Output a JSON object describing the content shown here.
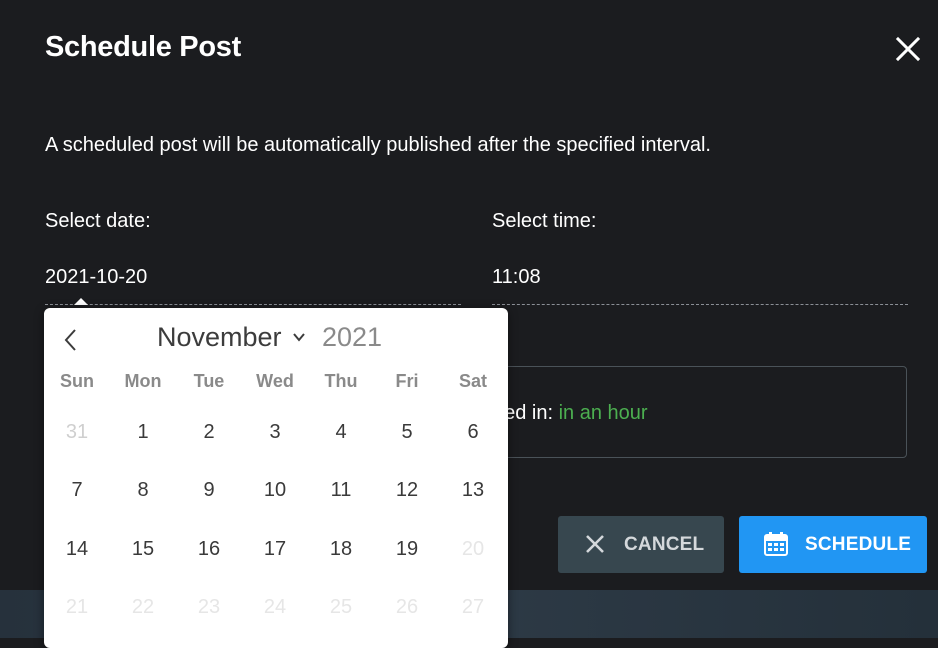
{
  "dialog": {
    "title": "Schedule Post",
    "description": "A scheduled post will be automatically published after the specified interval.",
    "date_label": "Select date:",
    "date_value": "2021-10-20",
    "time_label": "Select time:",
    "time_value": "11:08",
    "publish_info_visible": "hed in: ",
    "publish_info_value": "in an hour",
    "cancel_label": "CANCEL",
    "schedule_label": "SCHEDULE"
  },
  "calendar": {
    "month": "November",
    "year": "2021",
    "weekdays": [
      "Sun",
      "Mon",
      "Tue",
      "Wed",
      "Thu",
      "Fri",
      "Sat"
    ],
    "weeks": [
      [
        "31",
        "1",
        "2",
        "3",
        "4",
        "5",
        "6"
      ],
      [
        "7",
        "8",
        "9",
        "10",
        "11",
        "12",
        "13"
      ],
      [
        "14",
        "15",
        "16",
        "17",
        "18",
        "19",
        "20"
      ],
      [
        "21",
        "22",
        "23",
        "24",
        "25",
        "26",
        "27"
      ]
    ]
  },
  "colors": {
    "background": "#1b1c1f",
    "accent": "#2196f3",
    "highlight": "#4caf50",
    "cancel_bg": "#37474f"
  },
  "icons": {
    "close": "close-icon",
    "cancel": "close-icon",
    "schedule": "calendar-icon",
    "prev_month": "chevron-left-icon",
    "month_dropdown": "chevron-down-icon"
  }
}
